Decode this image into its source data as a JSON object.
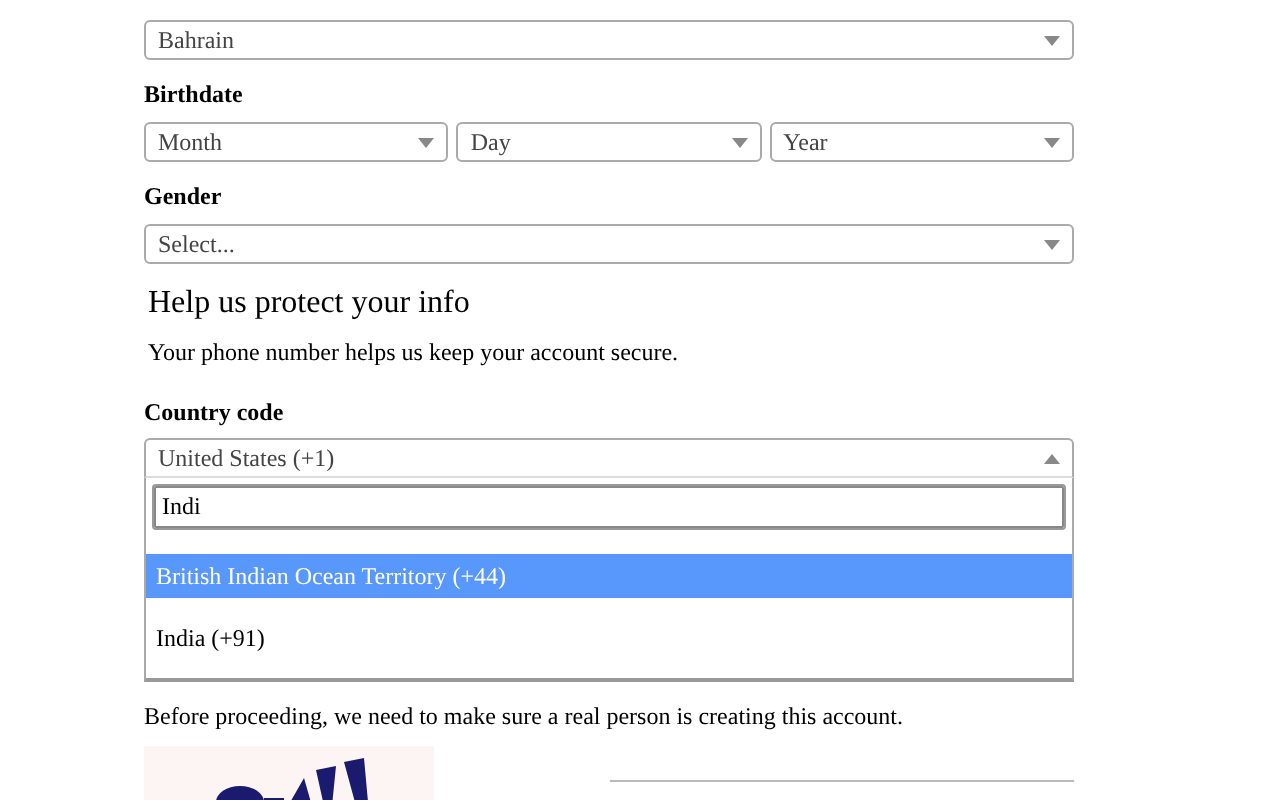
{
  "country_region": {
    "value": "Bahrain"
  },
  "birthdate": {
    "label": "Birthdate",
    "selects": [
      {
        "value": "Month"
      },
      {
        "value": "Day"
      },
      {
        "value": "Year"
      }
    ]
  },
  "gender": {
    "label": "Gender",
    "value": "Select..."
  },
  "protect": {
    "heading": "Help us protect your info",
    "text": "Your phone number helps us keep your account secure."
  },
  "country_code": {
    "label": "Country code",
    "value": "United States (+1)",
    "expanded": true,
    "search": "Indi",
    "options": [
      {
        "label": "British Indian Ocean Territory (+44)",
        "selected": true
      },
      {
        "label": "India (+91)",
        "selected": false
      }
    ]
  },
  "verification": {
    "text": "Before proceeding, we need to make sure a real person is creating this account."
  }
}
